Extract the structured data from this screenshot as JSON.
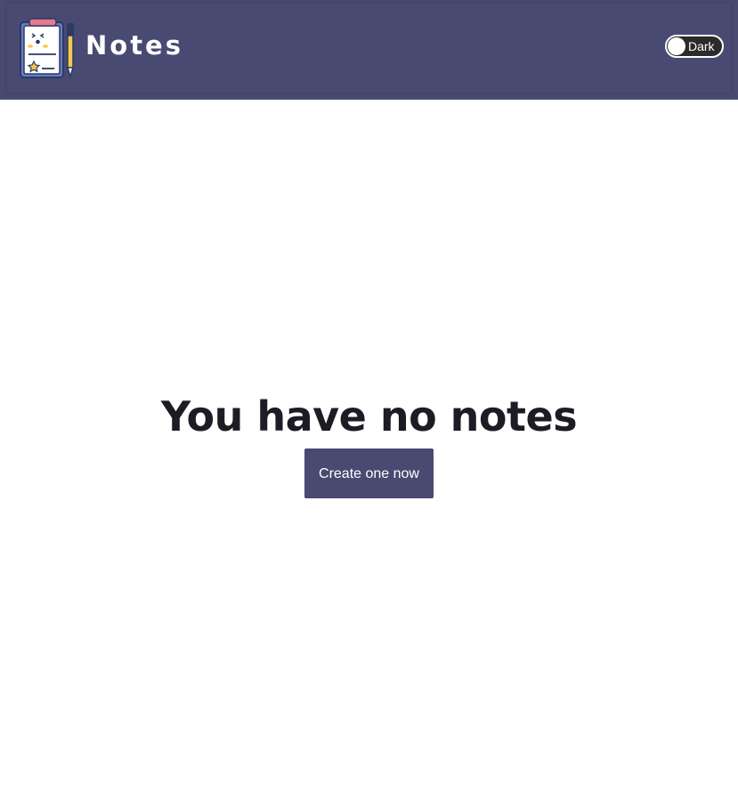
{
  "header": {
    "brand": "Notes",
    "logo_icon": "clipboard-notes-icon",
    "theme_toggle": {
      "label": "Dark",
      "state": "off"
    }
  },
  "main": {
    "empty_title": "You have no notes",
    "create_button_label": "Create one now"
  },
  "colors": {
    "header_bg": "#484a72",
    "button_bg": "#484a72",
    "page_bg": "#ffffff",
    "title_text": "#1c1c24"
  }
}
